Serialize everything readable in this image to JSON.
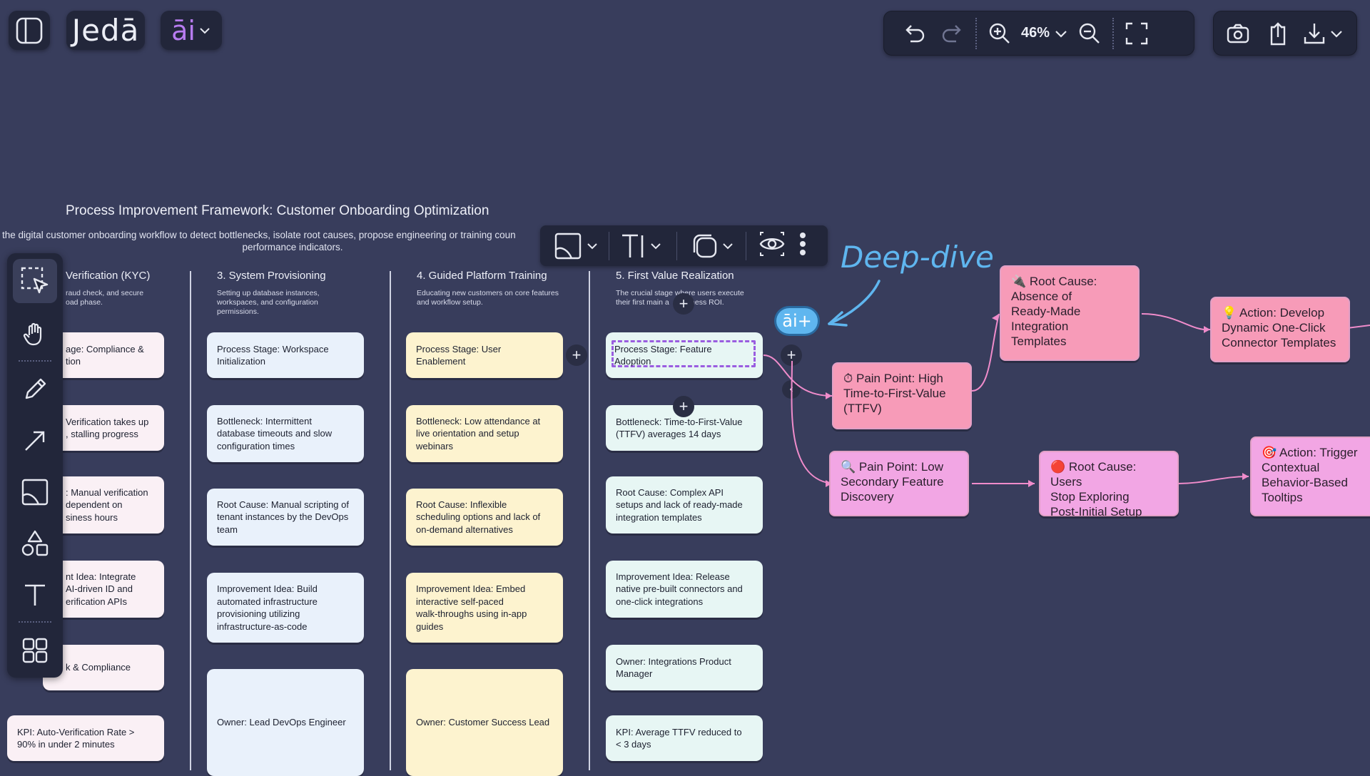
{
  "header": {
    "logo": "Jedā",
    "ai_menu": "āi",
    "zoom": "46%"
  },
  "board": {
    "title": "Process Improvement Framework: Customer Onboarding Optimization",
    "subtitle_line1": "the digital customer onboarding workflow to detect bottlenecks, isolate root causes, propose engineering or training coun",
    "subtitle_line2": "performance indicators.",
    "columns": [
      {
        "title": "Verification (KYC)",
        "desc": "raud check, and secure\noad phase.",
        "cards": [
          "age: Compliance &\ntion",
          "Verification takes up\n, stalling progress",
          ": Manual verification\ndependent on\nsiness hours",
          "nt Idea: Integrate\nAI-driven ID and\nerification APIs",
          "k & Compliance",
          "KPI: Auto-Verification Rate >\n90% in under 2 minutes"
        ]
      },
      {
        "title": "3. System Provisioning",
        "desc": "Setting up database instances,\nworkspaces, and configuration\npermissions.",
        "cards": [
          "Process Stage: Workspace\nInitialization",
          "Bottleneck: Intermittent\ndatabase timeouts and slow\nconfiguration times",
          "Root Cause: Manual scripting of\ntenant instances by the DevOps\nteam",
          "Improvement Idea: Build\nautomated infrastructure\nprovisioning utilizing\ninfrastructure-as-code",
          "Owner: Lead DevOps Engineer"
        ]
      },
      {
        "title": "4. Guided Platform Training",
        "desc": "Educating new customers on core features\nand workflow setup.",
        "cards": [
          "Process Stage: User\nEnablement",
          "Bottleneck: Low attendance at\nlive orientation and setup\nwebinars",
          "Root Cause: Inflexible\nscheduling options and lack of\non-demand alternatives",
          "Improvement Idea: Embed\ninteractive self-paced\nwalk-throughs using in-app\nguides",
          "Owner: Customer Success Lead"
        ]
      },
      {
        "title": "5. First Value Realization",
        "desc": "The crucial stage where users execute\ntheir first main a      witness ROI.",
        "cards": [
          "Process Stage: Feature\nAdoption",
          "Bottleneck: Time-to-First-Value\n(TTFV) averages 14 days",
          "Root Cause: Complex API\nsetups and lack of ready-made\nintegration templates",
          "Improvement Idea: Release\nnative pre-built connectors and\none-click integrations",
          "Owner: Integrations Product\nManager",
          "KPI: Average TTFV reduced to\n< 3 days"
        ]
      }
    ]
  },
  "deep_dive": {
    "label": "Deep-dive",
    "ai_plus": "āi+",
    "nodes": {
      "pain1": "⏱ Pain Point: High\nTime-to-First-Value\n(TTFV)",
      "root1": "🔌 Root Cause:\nAbsence of\nReady-Made\nIntegration\nTemplates",
      "action1": "💡 Action: Develop\nDynamic One-Click\nConnector Templates",
      "pain2": "🔍 Pain Point: Low\nSecondary Feature\nDiscovery",
      "root2": "🔴 Root Cause: Users\nStop Exploring\nPost-Initial Setup",
      "action2": "🎯 Action: Trigger\nContextual\nBehavior-Based\nTooltips"
    }
  },
  "colors": {
    "background": "#383d5c",
    "toolbar": "#22263a",
    "accent_purple": "#b77cf0",
    "deep_dive_blue": "#5fb6ef",
    "node_rose": "#f79bb8",
    "node_lavender": "#f2a6e4",
    "connector": "#f08ccb"
  },
  "icons": [
    "sidebar-toggle-icon",
    "undo-icon",
    "redo-icon",
    "zoom-in-icon",
    "chevron-down-icon",
    "zoom-out-icon",
    "fullscreen-icon",
    "camera-icon",
    "share-icon",
    "download-icon",
    "select-icon",
    "hand-icon",
    "pencil-icon",
    "arrow-icon",
    "image-icon",
    "shapes-icon",
    "text-icon",
    "templates-icon",
    "eye-icon",
    "more-icon",
    "plus-icon",
    "collapse-icon"
  ]
}
